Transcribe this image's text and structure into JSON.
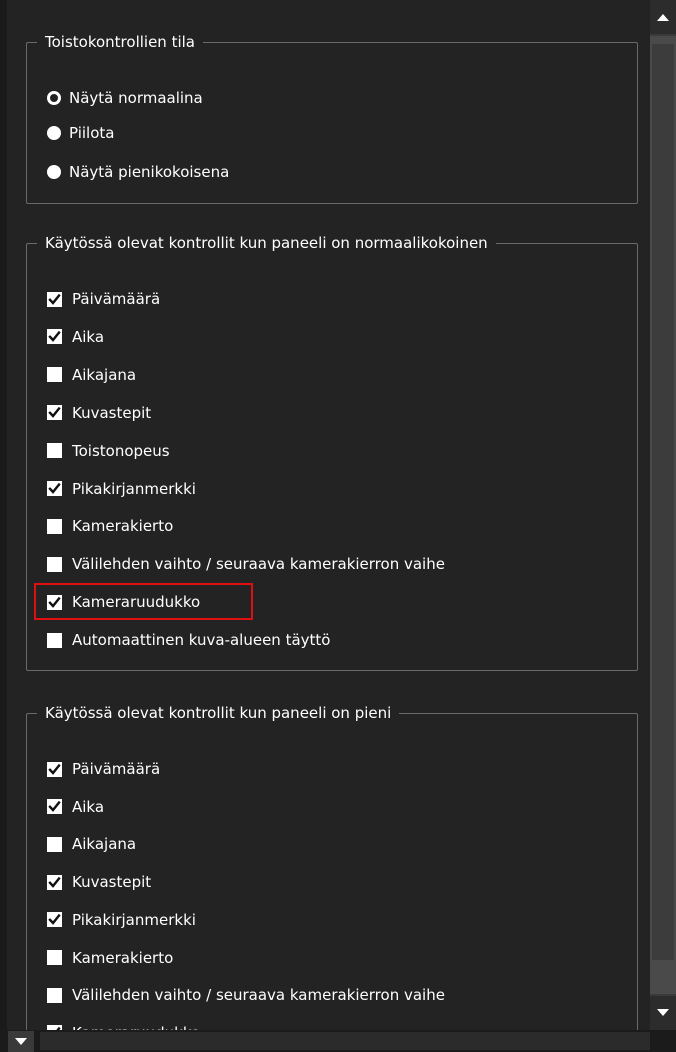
{
  "playback_mode": {
    "legend": "Toistokontrollien tila",
    "options": [
      {
        "label": "Näytä normaalina",
        "selected": true
      },
      {
        "label": "Piilota",
        "selected": false
      },
      {
        "label": "Näytä pienikokoisena",
        "selected": false
      }
    ]
  },
  "normal_controls": {
    "legend": "Käytössä olevat kontrollit kun paneeli on normaalikokoinen",
    "items": [
      {
        "label": "Päivämäärä",
        "checked": true
      },
      {
        "label": "Aika",
        "checked": true
      },
      {
        "label": "Aikajana",
        "checked": false
      },
      {
        "label": "Kuvastepit",
        "checked": true
      },
      {
        "label": "Toistonopeus",
        "checked": false
      },
      {
        "label": "Pikakirjanmerkki",
        "checked": true
      },
      {
        "label": "Kamerakierto",
        "checked": false
      },
      {
        "label": "Välilehden vaihto / seuraava kamerakierron vaihe",
        "checked": false
      },
      {
        "label": "Kameraruudukko",
        "checked": true
      },
      {
        "label": "Automaattinen kuva-alueen täyttö",
        "checked": false
      }
    ]
  },
  "small_controls": {
    "legend": "Käytössä olevat kontrollit kun paneeli on pieni",
    "items": [
      {
        "label": "Päivämäärä",
        "checked": true
      },
      {
        "label": "Aika",
        "checked": true
      },
      {
        "label": "Aikajana",
        "checked": false
      },
      {
        "label": "Kuvastepit",
        "checked": true
      },
      {
        "label": "Pikakirjanmerkki",
        "checked": true
      },
      {
        "label": "Kamerakierto",
        "checked": false
      },
      {
        "label": "Välilehden vaihto / seuraava kamerakierron vaihe",
        "checked": false
      },
      {
        "label": "Kameraruudukko",
        "checked": true
      }
    ]
  },
  "icons": {
    "scroll_up": "triangle-up-icon",
    "scroll_down": "triangle-down-icon",
    "check": "checkmark-icon"
  },
  "colors": {
    "highlight": "#e01010",
    "background": "#232323"
  }
}
